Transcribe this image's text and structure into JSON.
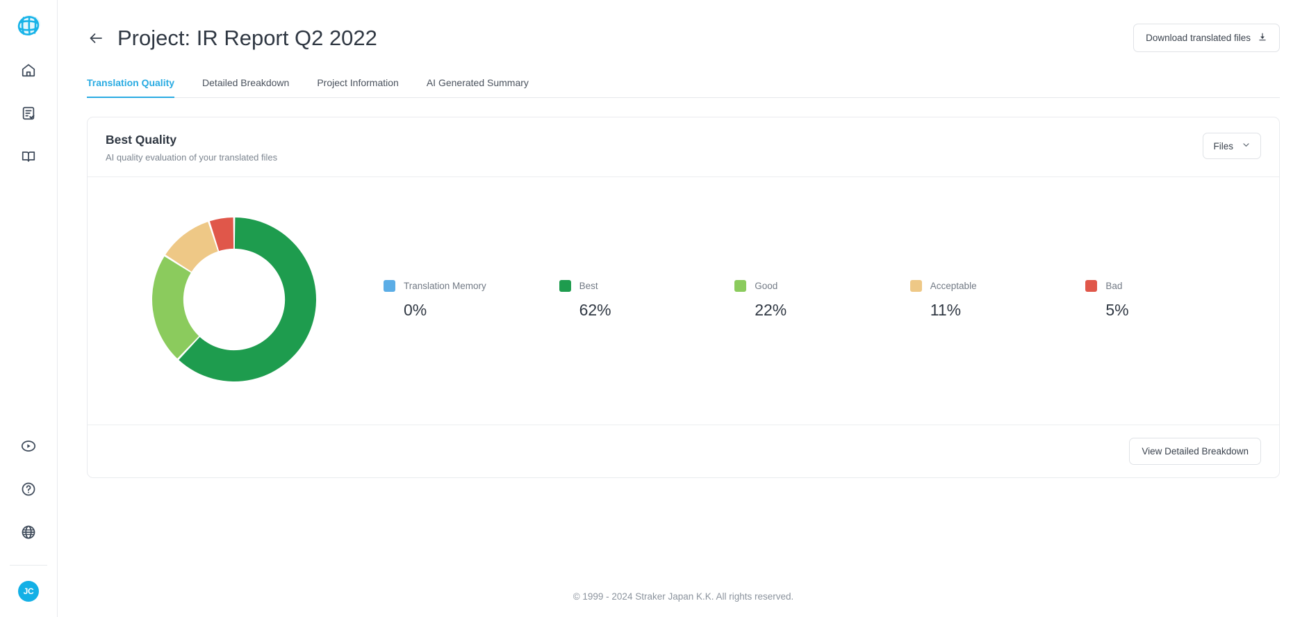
{
  "sidebar": {
    "logo_icon": "globe-grid-logo",
    "top_items": [
      {
        "icon": "home-icon",
        "name": "home"
      },
      {
        "icon": "document-check-icon",
        "name": "projects"
      },
      {
        "icon": "book-icon",
        "name": "glossary"
      }
    ],
    "bottom_items": [
      {
        "icon": "play-circle-icon",
        "name": "tutorials"
      },
      {
        "icon": "help-circle-icon",
        "name": "help"
      },
      {
        "icon": "globe-icon",
        "name": "language"
      }
    ],
    "avatar_initials": "JC"
  },
  "header": {
    "back_icon": "arrow-left-icon",
    "title": "Project: IR Report Q2 2022",
    "download_button": "Download translated files",
    "download_icon": "download-icon"
  },
  "tabs": [
    {
      "label": "Translation Quality",
      "active": true
    },
    {
      "label": "Detailed Breakdown",
      "active": false
    },
    {
      "label": "Project Information",
      "active": false
    },
    {
      "label": "AI Generated Summary",
      "active": false
    }
  ],
  "card": {
    "title": "Best Quality",
    "subtitle": "AI quality evaluation of your translated files",
    "files_select": "Files",
    "chevron_icon": "chevron-down-icon",
    "breakdown_button": "View Detailed Breakdown"
  },
  "chart_data": {
    "type": "pie",
    "title": "Best Quality",
    "subtitle": "AI quality evaluation of your translated files",
    "donut": true,
    "inner_radius_ratio": 0.62,
    "legend_position": "right",
    "categories": [
      "Translation Memory",
      "Best",
      "Good",
      "Acceptable",
      "Bad"
    ],
    "values": [
      0,
      62,
      22,
      11,
      5
    ],
    "value_labels": [
      "0%",
      "62%",
      "22%",
      "11%",
      "5%"
    ],
    "unit": "%",
    "colors": [
      "#5BADE6",
      "#1E9C4E",
      "#8BCB5D",
      "#EEC886",
      "#E0574A"
    ]
  },
  "footer": {
    "copyright": "© 1999 - 2024 Straker Japan K.K. All rights reserved."
  },
  "theme": {
    "accent": "#29ABE2",
    "text": "#2F3742",
    "muted": "#7B848F",
    "border": "#E6E8EB"
  }
}
